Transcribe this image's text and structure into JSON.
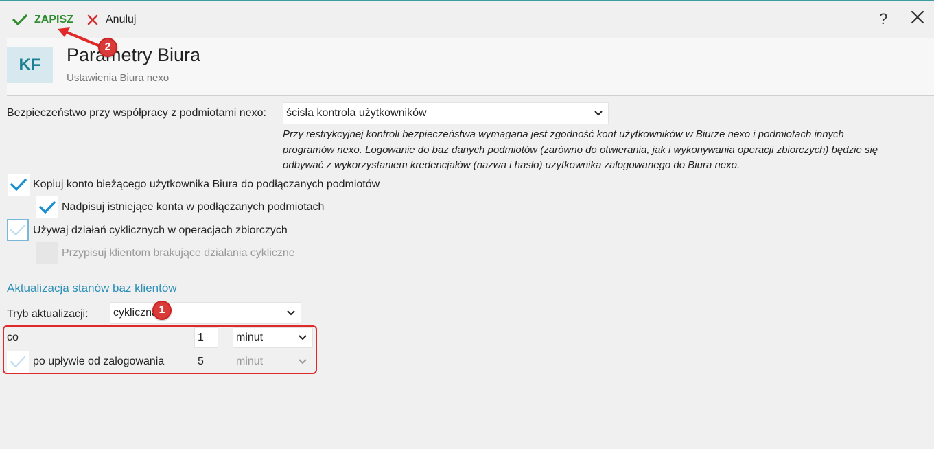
{
  "toolbar": {
    "save_label": "ZAPISZ",
    "cancel_label": "Anuluj",
    "help_label": "?"
  },
  "header": {
    "logo": "KF",
    "title": "Parametry Biura",
    "subtitle": "Ustawienia Biura nexo"
  },
  "security": {
    "label": "Bezpieczeństwo przy współpracy z podmiotami nexo:",
    "value": "ścisła kontrola użytkowników",
    "description": [
      "Przy restrykcyjnej kontroli bezpieczeństwa wymagana jest zgodność kont użytkowników w Biurze nexo i podmiotach innych",
      "programów nexo. Logowanie do baz danych podmiotów (zarówno do otwierania, jak i wykonywania operacji zbiorczych) będzie się",
      "odbywać z wykorzystaniem kredencjałów (nazwa i hasło) użytkownika zalogowanego do Biura nexo."
    ]
  },
  "options": {
    "copy_account": {
      "label": "Kopiuj konto bieżącego użytkownika Biura do podłączanych podmiotów",
      "checked": true
    },
    "overwrite_accounts": {
      "label": "Nadpisuj istniejące konta w podłączanych podmiotach",
      "checked": true
    },
    "cyclic_actions": {
      "label": "Używaj działań cyklicznych w operacjach zbiorczych",
      "checked": false
    },
    "assign_missing": {
      "label": "Przypisuj klientom brakujące działania cykliczne",
      "checked": false,
      "disabled": true
    }
  },
  "update": {
    "section_title": "Aktualizacja stanów baz klientów",
    "mode_label": "Tryb aktualizacji:",
    "mode_value": "cykliczna",
    "every_label": "co",
    "every_value": "1",
    "every_unit": "minut",
    "after_login_label": "po upływie od zalogowania",
    "after_login_value": "5",
    "after_login_unit": "minut"
  },
  "annotations": {
    "badge_1": "1",
    "badge_2": "2",
    "accent_color": "#e02a2a"
  }
}
